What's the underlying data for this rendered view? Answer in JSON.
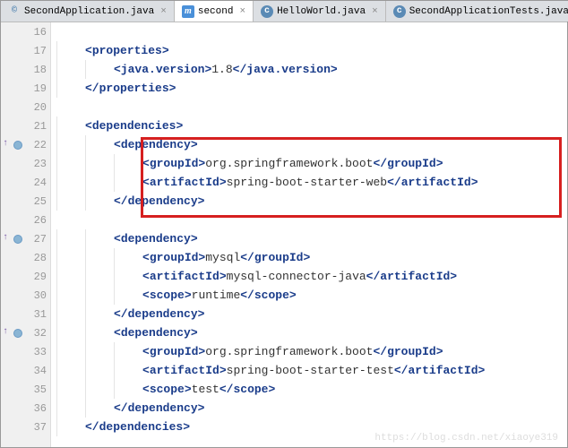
{
  "tabs": [
    {
      "label": "SecondApplication.java",
      "icon": "java",
      "active": false
    },
    {
      "label": "second",
      "icon": "m",
      "active": true
    },
    {
      "label": "HelloWorld.java",
      "icon": "c",
      "active": false
    },
    {
      "label": "SecondApplicationTests.java",
      "icon": "c",
      "active": false
    }
  ],
  "lines": {
    "16": "",
    "17": "",
    "18": "",
    "19": "",
    "20": "",
    "21": "",
    "22": "",
    "23": "",
    "24": "",
    "25": "",
    "26": "",
    "27": "",
    "28": "",
    "29": "",
    "30": "",
    "31": "",
    "32": "",
    "33": "",
    "34": "",
    "35": "",
    "36": "",
    "37": ""
  },
  "code": {
    "t_properties_o": "properties",
    "t_properties_c": "properties",
    "t_javaver_o": "java.version",
    "t_javaver_c": "java.version",
    "v_javaver": "1.8",
    "t_deps_o": "dependencies",
    "t_deps_c": "dependencies",
    "t_dep_o": "dependency",
    "t_dep_c": "dependency",
    "t_gid_o": "groupId",
    "t_gid_c": "groupId",
    "t_aid_o": "artifactId",
    "t_aid_c": "artifactId",
    "t_scope_o": "scope",
    "t_scope_c": "scope",
    "v_gid1": "org.springframework.boot",
    "v_aid1": "spring-boot-starter-web",
    "v_gid2": "mysql",
    "v_aid2": "mysql-connector-java",
    "v_scope2": "runtime",
    "v_gid3": "org.springframework.boot",
    "v_aid3": "spring-boot-starter-test",
    "v_scope3": "test"
  },
  "watermark": "https://blog.csdn.net/xiaoye319"
}
